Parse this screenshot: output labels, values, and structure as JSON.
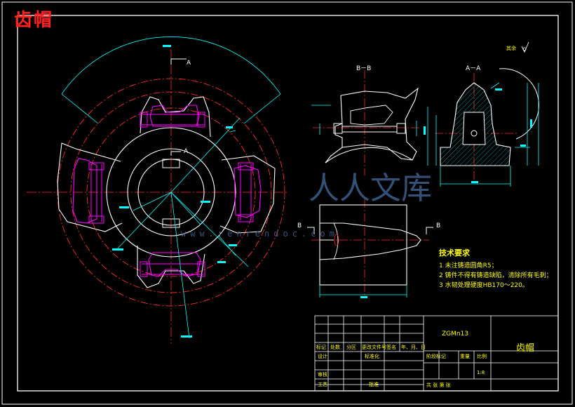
{
  "title": "齿帽",
  "section_labels": {
    "a": "A",
    "b": "B",
    "bb": "B－B",
    "aa": "A－A"
  },
  "surface_mark": "其余",
  "notes": {
    "heading": "技术要求",
    "items": [
      "1 未注铸造圆角R5；",
      "2 铸件不得有铸造缺陷，清除所有毛刺；",
      "3 水韧处理硬度HB170～220。"
    ]
  },
  "title_block": {
    "material": "ZGMn13",
    "part_name": "齿帽",
    "headers": [
      "标记",
      "处数",
      "分区",
      "更改文件号",
      "签名",
      "年、月、日"
    ],
    "design": "设计",
    "standardize": "标准化",
    "review": "审核",
    "process": "工艺",
    "approve": "批准",
    "stage_mark": "阶段标记",
    "weight": "重量",
    "scale_label": "比例",
    "scale_value": "1:8",
    "sheets": "共   张  第   张"
  },
  "watermark": {
    "cn": "人人文库",
    "url": "www.renrendoc.com"
  },
  "colors": {
    "background": "#000000",
    "frame": "#ffffff",
    "outline": "#ffffff",
    "centerline": "#ff2a2a",
    "dimension": "#00ffff",
    "hidden": "#ff00ff",
    "hatch": "#00ffff",
    "text": "#ffff00"
  }
}
